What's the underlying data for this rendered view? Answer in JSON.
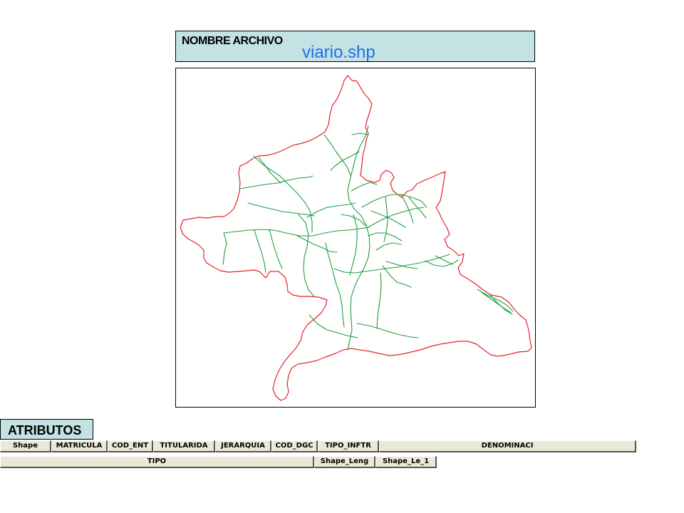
{
  "file": {
    "label": "NOMBRE ARCHIVO",
    "name": "viario.shp"
  },
  "map": {
    "boundary_color": "#e8202a",
    "road_color": "#1e9e3c"
  },
  "attributes": {
    "title": "ATRIBUTOS",
    "row1": [
      "Shape",
      "MATRICULA",
      "COD_ENT",
      "TITULARIDA",
      "JERARQUIA",
      "COD_DGC",
      "TIPO_INFTR",
      "DENOMINACI"
    ],
    "row2": [
      "TIPO",
      "Shape_Leng",
      "Shape_Le_1"
    ]
  }
}
